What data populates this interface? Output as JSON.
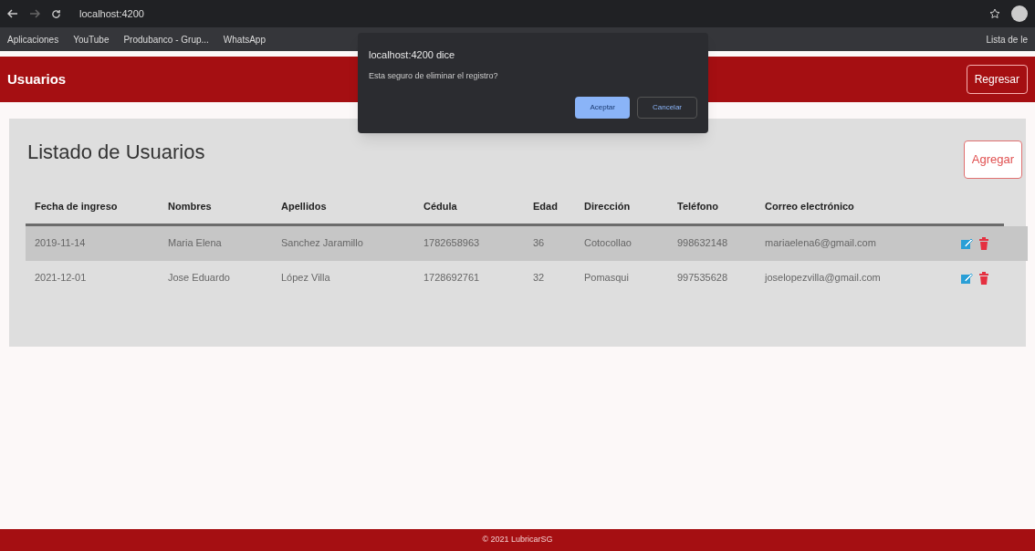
{
  "browser": {
    "address": "localhost:4200",
    "bookmarks": [
      "Aplicaciones",
      "YouTube",
      "Produbanco - Grup...",
      "WhatsApp"
    ],
    "reading_list": "Lista de le"
  },
  "dialog": {
    "title": "localhost:4200 dice",
    "message": "Esta seguro de eliminar el registro?",
    "buttons": [
      {
        "label": "Aceptar",
        "selected": true
      },
      {
        "label": "Cancelar",
        "selected": false
      }
    ]
  },
  "header": {
    "title": "Usuarios",
    "back_button": "Regresar"
  },
  "panel": {
    "title": "Listado de Usuarios",
    "add_button": "Agregar"
  },
  "table": {
    "columns": [
      "Fecha de ingreso",
      "Nombres",
      "Apellidos",
      "Cédula",
      "Edad",
      "Dirección",
      "Teléfono",
      "Correo electrónico"
    ],
    "rows": [
      {
        "selected": true,
        "cells": [
          "2019-11-14",
          "Maria Elena",
          "Sanchez Jaramillo",
          "1782658963",
          "36",
          "Cotocollao",
          "998632148",
          "mariaelena6@gmail.com"
        ]
      },
      {
        "selected": false,
        "cells": [
          "2021-12-01",
          "Jose Eduardo",
          "López Villa",
          "1728692761",
          "32",
          "Pomasqui",
          "997535628",
          "joselopezvilla@gmail.com"
        ]
      }
    ]
  },
  "footer": "© 2021 LubricarSG"
}
